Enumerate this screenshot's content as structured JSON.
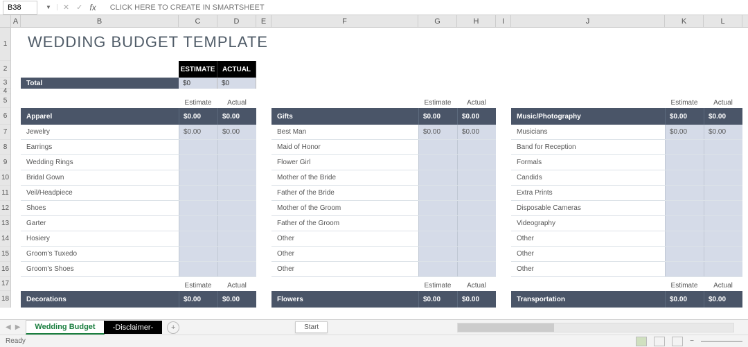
{
  "formula_bar": {
    "name_box": "B38",
    "content": "CLICK HERE TO CREATE IN SMARTSHEET"
  },
  "columns": [
    "A",
    "B",
    "C",
    "D",
    "E",
    "F",
    "G",
    "H",
    "I",
    "J",
    "K",
    "L"
  ],
  "rows": [
    "1",
    "2",
    "3",
    "4",
    "5",
    "6",
    "7",
    "8",
    "9",
    "10",
    "11",
    "12",
    "13",
    "14",
    "15",
    "16",
    "17",
    "18"
  ],
  "title": "WEDDING BUDGET TEMPLATE",
  "headers": {
    "estimate": "ESTIMATE",
    "actual": "ACTUAL"
  },
  "total_row": {
    "label": "Total",
    "estimate": "$0",
    "actual": "$0"
  },
  "labels": {
    "estimate": "Estimate",
    "actual": "Actual"
  },
  "section1": {
    "title": "Apparel",
    "estimate": "$0.00",
    "actual": "$0.00",
    "items": [
      {
        "label": "Jewelry",
        "estimate": "$0.00",
        "actual": "$0.00"
      },
      {
        "label": "Earrings",
        "estimate": "",
        "actual": ""
      },
      {
        "label": "Wedding Rings",
        "estimate": "",
        "actual": ""
      },
      {
        "label": "Bridal Gown",
        "estimate": "",
        "actual": ""
      },
      {
        "label": "Veil/Headpiece",
        "estimate": "",
        "actual": ""
      },
      {
        "label": "Shoes",
        "estimate": "",
        "actual": ""
      },
      {
        "label": "Garter",
        "estimate": "",
        "actual": ""
      },
      {
        "label": "Hosiery",
        "estimate": "",
        "actual": ""
      },
      {
        "label": "Groom's Tuxedo",
        "estimate": "",
        "actual": ""
      },
      {
        "label": "Groom's Shoes",
        "estimate": "",
        "actual": ""
      }
    ],
    "footer": {
      "title": "Decorations",
      "estimate": "$0.00",
      "actual": "$0.00"
    }
  },
  "section2": {
    "title": "Gifts",
    "estimate": "$0.00",
    "actual": "$0.00",
    "items": [
      {
        "label": "Best Man",
        "estimate": "$0.00",
        "actual": "$0.00"
      },
      {
        "label": "Maid of Honor",
        "estimate": "",
        "actual": ""
      },
      {
        "label": "Flower Girl",
        "estimate": "",
        "actual": ""
      },
      {
        "label": "Mother of the Bride",
        "estimate": "",
        "actual": ""
      },
      {
        "label": "Father of the Bride",
        "estimate": "",
        "actual": ""
      },
      {
        "label": "Mother of the Groom",
        "estimate": "",
        "actual": ""
      },
      {
        "label": "Father of the Groom",
        "estimate": "",
        "actual": ""
      },
      {
        "label": "Other",
        "estimate": "",
        "actual": ""
      },
      {
        "label": "Other",
        "estimate": "",
        "actual": ""
      },
      {
        "label": "Other",
        "estimate": "",
        "actual": ""
      }
    ],
    "footer": {
      "title": "Flowers",
      "estimate": "$0.00",
      "actual": "$0.00"
    }
  },
  "section3": {
    "title": "Music/Photography",
    "estimate": "$0.00",
    "actual": "$0.00",
    "items": [
      {
        "label": "Musicians",
        "estimate": "$0.00",
        "actual": "$0.00"
      },
      {
        "label": "Band for Reception",
        "estimate": "",
        "actual": ""
      },
      {
        "label": "Formals",
        "estimate": "",
        "actual": ""
      },
      {
        "label": "Candids",
        "estimate": "",
        "actual": ""
      },
      {
        "label": "Extra Prints",
        "estimate": "",
        "actual": ""
      },
      {
        "label": "Disposable Cameras",
        "estimate": "",
        "actual": ""
      },
      {
        "label": "Videography",
        "estimate": "",
        "actual": ""
      },
      {
        "label": "Other",
        "estimate": "",
        "actual": ""
      },
      {
        "label": "Other",
        "estimate": "",
        "actual": ""
      },
      {
        "label": "Other",
        "estimate": "",
        "actual": ""
      }
    ],
    "footer": {
      "title": "Transportation",
      "estimate": "$0.00",
      "actual": "$0.00"
    }
  },
  "tabs": {
    "active": "Wedding Budget",
    "disclaimer": "-Disclaimer-"
  },
  "status": {
    "ready": "Ready",
    "start": "Start"
  }
}
